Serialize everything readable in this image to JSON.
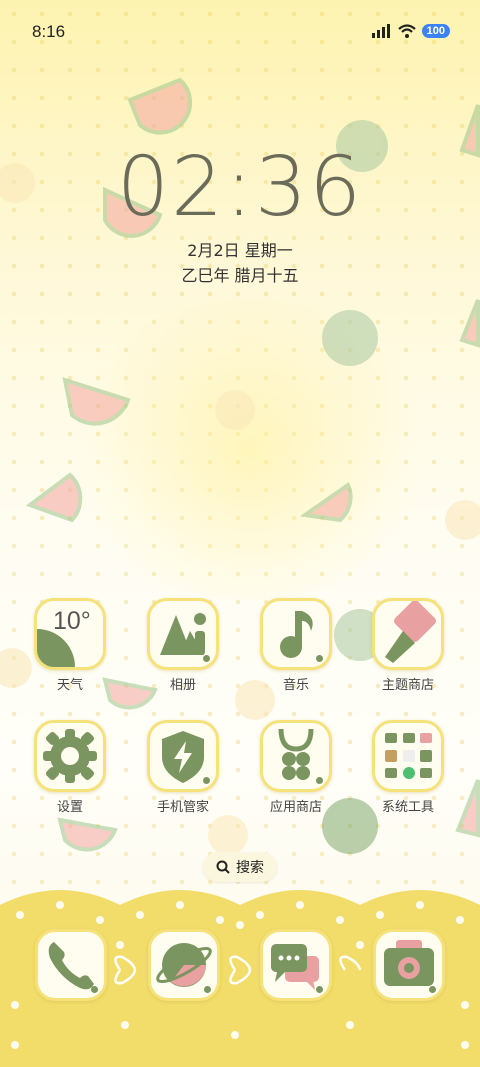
{
  "status": {
    "time": "8:16",
    "battery": "100"
  },
  "clock": {
    "time": "02:36",
    "date": "2月2日 星期一",
    "lunar": "乙巳年 腊月十五"
  },
  "weather": {
    "temp": "10°"
  },
  "apps_row1": [
    {
      "label": "天气",
      "icon": "weather-icon"
    },
    {
      "label": "相册",
      "icon": "gallery-icon"
    },
    {
      "label": "音乐",
      "icon": "music-icon"
    },
    {
      "label": "主题商店",
      "icon": "theme-store-icon"
    }
  ],
  "apps_row2": [
    {
      "label": "设置",
      "icon": "settings-icon"
    },
    {
      "label": "手机管家",
      "icon": "security-icon"
    },
    {
      "label": "应用商店",
      "icon": "app-store-icon"
    },
    {
      "label": "系统工具",
      "icon": "folder-icon"
    }
  ],
  "search": {
    "label": "搜索"
  },
  "dock": [
    {
      "icon": "phone-icon"
    },
    {
      "icon": "browser-icon"
    },
    {
      "icon": "messages-icon"
    },
    {
      "icon": "camera-icon"
    }
  ],
  "colors": {
    "accent_green": "#7a9560",
    "tile_border": "#f6e27a",
    "dock_yellow": "#f2dd6a",
    "pink": "#e8a0a0"
  }
}
